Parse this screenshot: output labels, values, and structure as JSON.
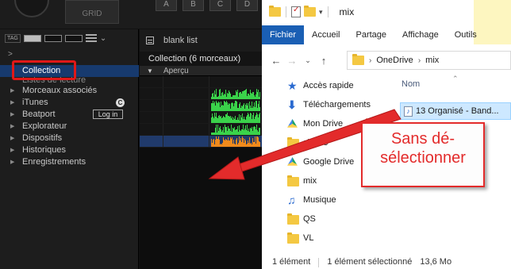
{
  "dj_app": {
    "grid_label": "GRID",
    "pads": [
      "A",
      "B",
      "C",
      "D"
    ],
    "tag_label": "TAG",
    "sidebar": {
      "items": [
        {
          "label": "Collection",
          "selected": true
        },
        {
          "label": "Listes de lecture",
          "partial": true
        },
        {
          "label": "Morceaux associés"
        },
        {
          "label": "iTunes"
        },
        {
          "label": "Beatport",
          "button": "Log in"
        },
        {
          "label": "Explorateur"
        },
        {
          "label": "Dispositifs"
        },
        {
          "label": "Historiques"
        },
        {
          "label": "Enregistrements"
        }
      ]
    },
    "panel": {
      "list_title": "blank list",
      "collection_header": "Collection (6 morceaux)",
      "preview_col": "Aperçu"
    }
  },
  "explorer": {
    "title": "mix",
    "ribbon_tabs": [
      "Fichier",
      "Accueil",
      "Partage",
      "Affichage",
      "Outils"
    ],
    "breadcrumb": [
      "OneDrive",
      "mix"
    ],
    "nav_items": [
      {
        "label": "Accès rapide",
        "icon": "star-icon"
      },
      {
        "label": "Téléchargements",
        "icon": "download-icon"
      },
      {
        "label": "Mon Drive",
        "icon": "google-drive-icon",
        "pinned": true
      },
      {
        "label": "shows",
        "icon": "folder-icon"
      },
      {
        "label": "Google Drive",
        "icon": "google-drive-icon"
      },
      {
        "label": "mix",
        "icon": "folder-icon"
      },
      {
        "label": "Musique",
        "icon": "music-icon"
      },
      {
        "label": "QS",
        "icon": "folder-icon"
      },
      {
        "label": "VL",
        "icon": "folder-icon"
      }
    ],
    "column_name": "Nom",
    "file_name": "13 Organisé - Band...",
    "status": {
      "count": "1 élément",
      "selected": "1 élément sélectionné",
      "size": "13,6 Mo"
    }
  },
  "annotation": {
    "callout_text": "Sans dé-sélectionner",
    "color": "#e32b2b"
  },
  "colors": {
    "selection_blue": "#173a6e",
    "file_tab_blue": "#1a5fb4",
    "waveform_green": "#3ad24a",
    "waveform_orange": "#f08a1c"
  }
}
